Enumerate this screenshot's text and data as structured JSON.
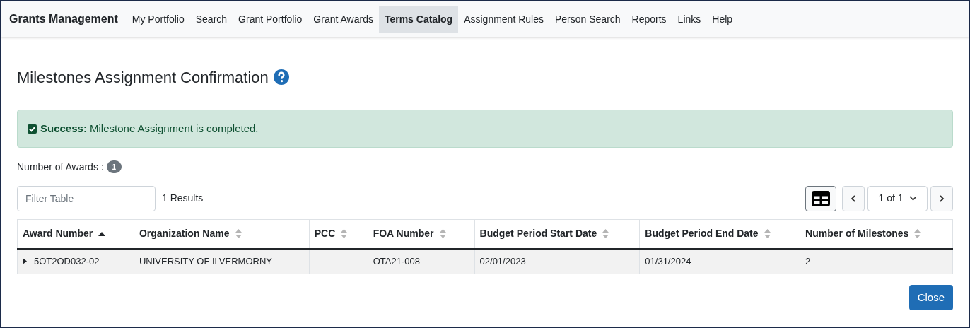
{
  "nav": {
    "brand": "Grants Management",
    "items": [
      {
        "label": "My Portfolio",
        "selected": false
      },
      {
        "label": "Search",
        "selected": false
      },
      {
        "label": "Grant Portfolio",
        "selected": false
      },
      {
        "label": "Grant Awards",
        "selected": false
      },
      {
        "label": "Terms Catalog",
        "selected": true
      },
      {
        "label": "Assignment Rules",
        "selected": false
      },
      {
        "label": "Person Search",
        "selected": false
      },
      {
        "label": "Reports",
        "selected": false
      },
      {
        "label": "Links",
        "selected": false
      },
      {
        "label": "Help",
        "selected": false
      }
    ]
  },
  "page_title": "Milestones Assignment Confirmation",
  "alert": {
    "text": "**Success:** Milestone Assignment is completed."
  },
  "awards_count": {
    "label": "Number of Awards :",
    "count": "1"
  },
  "filter": {
    "placeholder": "Filter Table"
  },
  "results": "1 Results",
  "pagination": {
    "page": "1 of 1"
  },
  "table": {
    "columns": [
      {
        "label": "Award Number",
        "sorted": true
      },
      {
        "label": "Organization Name",
        "sorted": false
      },
      {
        "label": "PCC",
        "sorted": false
      },
      {
        "label": "FOA Number",
        "sorted": false
      },
      {
        "label": "Budget Period Start Date",
        "sorted": false
      },
      {
        "label": "Budget Period End Date",
        "sorted": false
      },
      {
        "label": "Number of Milestones",
        "sorted": false
      }
    ],
    "rows": [
      {
        "expanded": false,
        "cells": [
          "5OT2OD032-02",
          "UNIVERSITY OF ILVERMORNY",
          "",
          "OTA21-008",
          "02/01/2023",
          "01/31/2024",
          "2"
        ]
      }
    ]
  },
  "close_button": "Close"
}
